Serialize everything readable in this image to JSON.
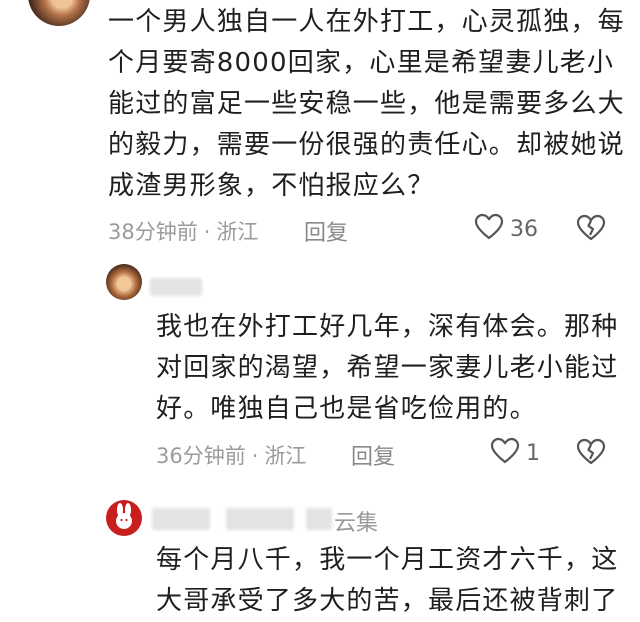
{
  "comments": [
    {
      "text": "一个男人独自一人在外打工，心灵孤独，每个月要寄8000回家，心里是希望妻儿老小能过的富足一些安稳一些，他是需要多么大的毅力，需要一份很强的责任心。却被她说成渣男形象，不怕报应么？",
      "time": "38分钟前",
      "location": "浙江",
      "reply_label": "回复",
      "likes": "36"
    },
    {
      "author": "",
      "text": "我也在外打工好几年，深有体会。那种对回家的渴望，希望一家妻儿老小能过好。唯独自己也是省吃俭用的。",
      "time": "36分钟前",
      "location": "浙江",
      "reply_label": "回复",
      "likes": "1"
    },
    {
      "author_suffix": "云集",
      "text": "每个月八千，我一个月工资才六千，这大哥承受了多大的苦，最后还被背刺了"
    }
  ],
  "meta_separator": "·",
  "icons": {
    "like": "heart-outline-icon",
    "dislike": "broken-heart-icon"
  },
  "colors": {
    "text": "#1f1f1f",
    "meta": "#9b9b9b",
    "avatar_red": "#c81e1e"
  }
}
